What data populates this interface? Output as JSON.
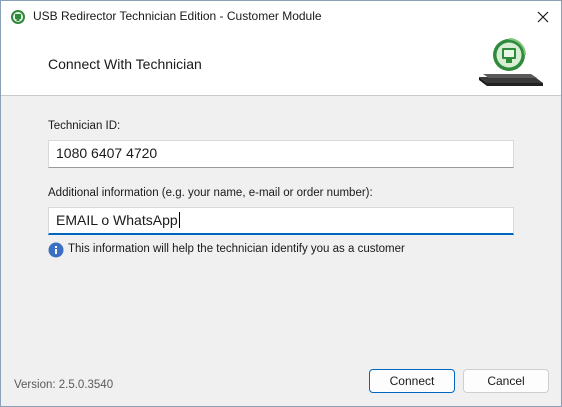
{
  "window": {
    "title": "USB Redirector Technician Edition - Customer Module"
  },
  "header": {
    "title": "Connect With Technician"
  },
  "form": {
    "technician_id_label": "Technician ID:",
    "technician_id_value": "1080 6407 4720",
    "additional_info_label": "Additional information (e.g. your name, e-mail or order number):",
    "additional_info_value": "EMAIL o WhatsApp",
    "hint": "This information will help the technician identify you as a customer"
  },
  "footer": {
    "version": "Version: 2.5.0.3540",
    "connect_label": "Connect",
    "cancel_label": "Cancel"
  },
  "colors": {
    "accent": "#0067c0",
    "info_icon": "#3a6fc4"
  }
}
